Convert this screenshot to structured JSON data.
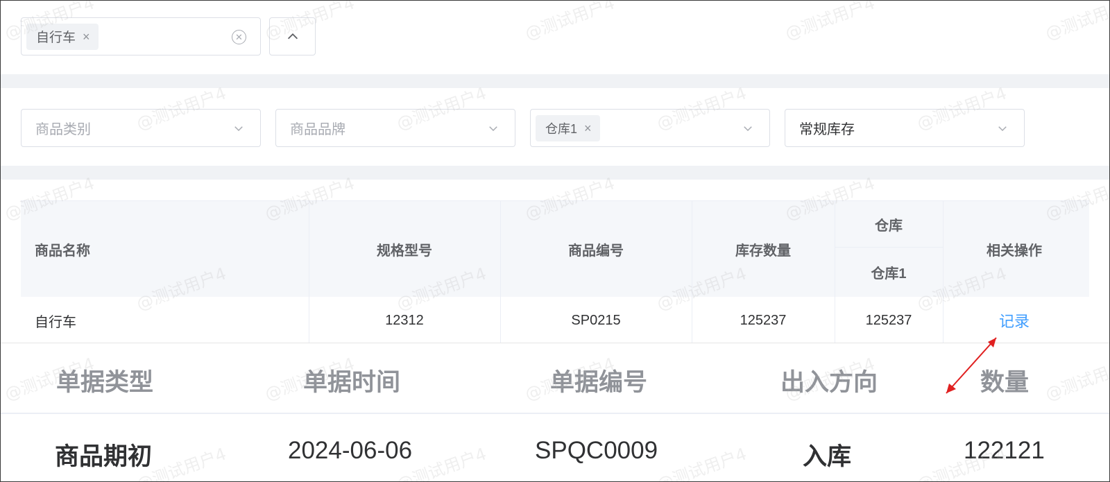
{
  "top_filter": {
    "tag_label": "自行车",
    "tag_close": "×"
  },
  "filters": {
    "category_placeholder": "商品类别",
    "brand_placeholder": "商品品牌",
    "warehouse_tag": "仓库1",
    "warehouse_tag_close": "×",
    "stock_type_value": "常规库存"
  },
  "table": {
    "headers": {
      "name": "商品名称",
      "spec": "规格型号",
      "code": "商品编号",
      "qty": "库存数量",
      "warehouse_group": "仓库",
      "warehouse_1": "仓库1",
      "actions": "相关操作"
    },
    "rows": [
      {
        "name": "自行车",
        "spec": "12312",
        "code": "SP0215",
        "qty": "125237",
        "warehouse_1": "125237",
        "action": "记录"
      }
    ]
  },
  "record_detail": {
    "headers": {
      "doc_type": "单据类型",
      "doc_time": "单据时间",
      "doc_no": "单据编号",
      "direction": "出入方向",
      "quantity": "数量"
    },
    "rows": [
      {
        "doc_type": "商品期初",
        "doc_time": "2024-06-06",
        "doc_no": "SPQC0009",
        "direction": "入库",
        "quantity": "122121"
      }
    ]
  },
  "watermark_text": "@测试用户4",
  "colors": {
    "link": "#409eff",
    "arrow": "#e02020",
    "header_bg": "#f5f7fa",
    "band": "#f0f2f5"
  }
}
